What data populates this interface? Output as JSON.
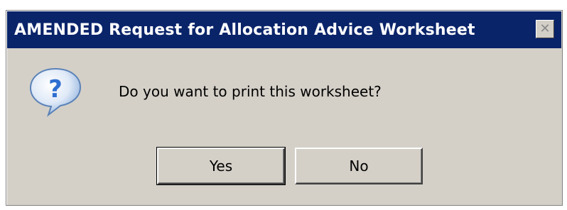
{
  "dialog": {
    "title": "AMENDED Request for Allocation Advice Worksheet",
    "close_symbol": "✕",
    "icon": "question-balloon-icon",
    "message": "Do you want to print this worksheet?",
    "buttons": {
      "yes_label": "Yes",
      "no_label": "No"
    }
  },
  "colors": {
    "titlebar": "#0a246a",
    "dialog_face": "#d4d0c8",
    "icon_blue": "#2f6fd0"
  }
}
